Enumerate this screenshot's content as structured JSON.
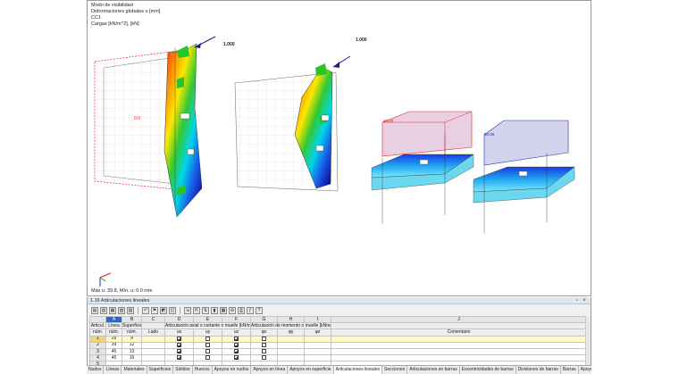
{
  "info": {
    "line1": "Modo de visibilidad",
    "line2": "Deformaciones globales u [mm]",
    "line3": "CC1",
    "line4": "Cargas [kN/m^2], [kN]"
  },
  "status": "Máx u: 39.8, Mín. u: 0.0 mm",
  "load_values": [
    "1.000",
    "1.000",
    "50.00",
    "50.00"
  ],
  "panel": {
    "title": "1.16 Articulaciones lineales",
    "columns": [
      "A",
      "B",
      "C",
      "D",
      "E",
      "F",
      "G",
      "H",
      "I",
      "J"
    ],
    "group_headers": {
      "art": "Articul.",
      "linea": "Línea",
      "superficie": "Superficie",
      "axial": "Articulación axial o cortante o muelle [kN/m²]",
      "momento": "Articulación de momento o muelle [kNm/rad/m]"
    },
    "sub_headers": {
      "num": "núm.",
      "linea_num": "núm.",
      "superficie_num": "núm.",
      "lado": "Lado",
      "ux": "ux",
      "uy": "uy",
      "uz": "uz",
      "phx": "φx",
      "phy": "φy",
      "phz": "φz",
      "comentario": "Comentario"
    },
    "rows": [
      {
        "num": "1",
        "linea": "29",
        "superficie": "9",
        "ux": true,
        "uy": false,
        "uz": true,
        "phx": false
      },
      {
        "num": "2",
        "linea": "39",
        "superficie": "12",
        "ux": true,
        "uy": false,
        "uz": true,
        "phx": false
      },
      {
        "num": "3",
        "linea": "45",
        "superficie": "13",
        "ux": true,
        "uy": false,
        "uz": true,
        "phx": false
      },
      {
        "num": "4",
        "linea": "45",
        "superficie": "16",
        "ux": true,
        "uy": false,
        "uz": true,
        "phx": false
      },
      {
        "num": "5",
        "linea": "",
        "superficie": "",
        "ux": null,
        "uy": null,
        "uz": null,
        "phx": null
      }
    ]
  },
  "tabs": [
    "Nudos",
    "Líneas",
    "Materiales",
    "Superficies",
    "Sólidos",
    "Huecos",
    "Apoyos en nudos",
    "Apoyos en línea",
    "Apoyos en superficie",
    "Articulaciones lineales",
    "Secciones",
    "Articulaciones en barras",
    "Excentricidades de barras",
    "Divisiones de barras",
    "Barras",
    "Apoyos elásticos en barra"
  ],
  "active_tab": "Articulaciones lineales"
}
